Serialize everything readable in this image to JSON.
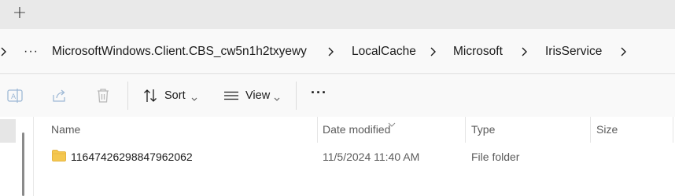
{
  "tabstrip": {
    "new_tab_glyph": "+"
  },
  "address": {
    "overflow_glyph": "›",
    "more_glyph": "···",
    "crumbs": [
      "MicrosoftWindows.Client.CBS_cw5n1h2txyewy",
      "LocalCache",
      "Microsoft",
      "IrisService"
    ]
  },
  "toolbar": {
    "sort_label": "Sort",
    "view_label": "View",
    "more_label": "···"
  },
  "columns": {
    "name": "Name",
    "date_modified": "Date modified",
    "type": "Type",
    "size": "Size"
  },
  "files": [
    {
      "name": "11647426298847962062",
      "date_modified": "11/5/2024 11:40 AM",
      "type": "File folder",
      "size": ""
    }
  ],
  "colors": {
    "folder": "#f4c74f",
    "accent": "#005fb8"
  }
}
